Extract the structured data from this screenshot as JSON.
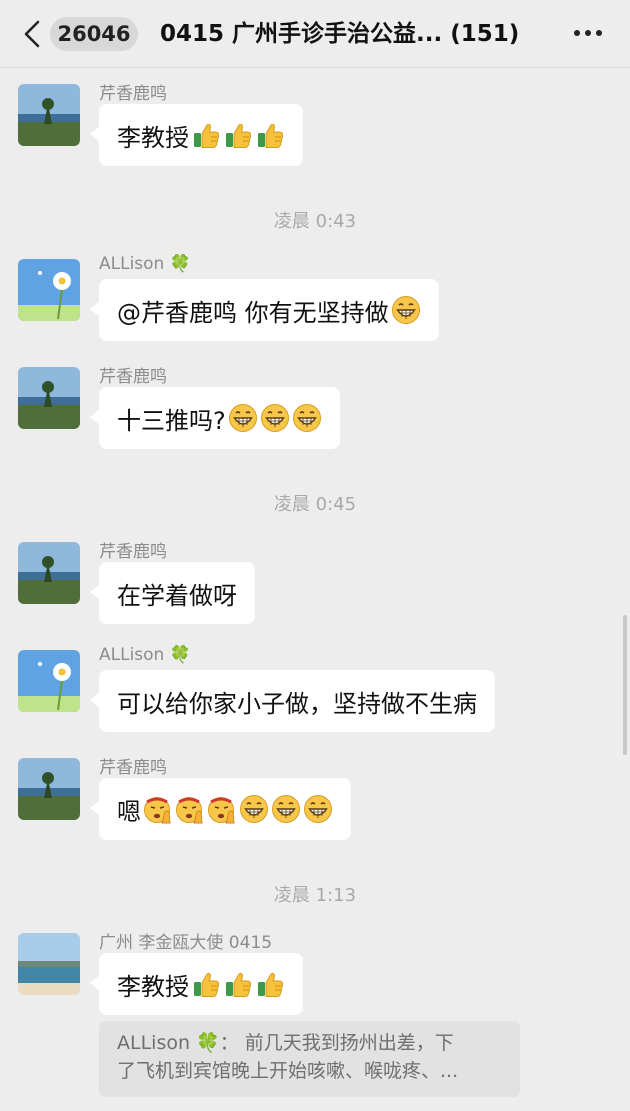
{
  "header": {
    "unread_count": "26046",
    "title": "0415 广州手诊手治公益... (151)"
  },
  "times": [
    "凌晨 0:43",
    "凌晨 0:45",
    "凌晨 1:13"
  ],
  "messages": [
    {
      "sender": "芹香鹿鸣",
      "text": "李教授",
      "emoji": [
        "thumbs-up",
        "thumbs-up",
        "thumbs-up"
      ]
    },
    {
      "sender": "ALLison 🍀",
      "text": "@芹香鹿鸣 你有无坚持做",
      "emoji": [
        "grin"
      ]
    },
    {
      "sender": "芹香鹿鸣",
      "text": "十三推吗?",
      "emoji": [
        "grin",
        "grin",
        "grin"
      ]
    },
    {
      "sender": "芹香鹿鸣",
      "text": "在学着做呀",
      "emoji": []
    },
    {
      "sender": "ALLison 🍀",
      "text": "可以给你家小子做，坚持做不生病",
      "emoji": []
    },
    {
      "sender": "芹香鹿鸣",
      "text": "嗯",
      "emoji": [
        "salute",
        "salute",
        "salute",
        "grin",
        "grin",
        "grin"
      ]
    },
    {
      "sender": "广州 李金瓯大使 0415",
      "text": "李教授",
      "emoji": [
        "thumbs-up",
        "thumbs-up",
        "thumbs-up"
      ]
    }
  ],
  "quote": {
    "line1": "ALLison 🍀：  前几天我到扬州出差，下",
    "line2": "了飞机到宾馆晚上开始咳嗽、喉咙疼、..."
  },
  "colors": {
    "background": "#ededed",
    "bubble": "#ffffff",
    "quote": "#e2e2e2"
  }
}
